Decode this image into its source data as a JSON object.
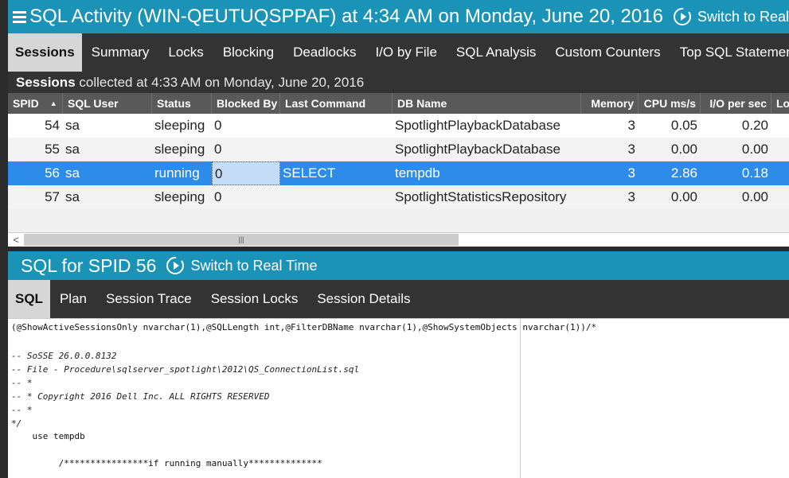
{
  "header": {
    "title": "SQL Activity (WIN-QEUTUQSPPAF) at 4:34 AM on Monday, June 20, 2016",
    "realtime_label": "Switch to Real"
  },
  "tabs": [
    "Sessions",
    "Summary",
    "Locks",
    "Blocking",
    "Deadlocks",
    "I/O by File",
    "SQL Analysis",
    "Custom Counters",
    "Top SQL Statements"
  ],
  "info": {
    "bold": "Sessions",
    "text": " collected at 4:33 AM on Monday, June 20, 2016"
  },
  "grid": {
    "columns": [
      "SPID",
      "SQL User",
      "Status",
      "Blocked By",
      "Last Command",
      "DB Name",
      "Memory",
      "CPU ms/s",
      "I/O per sec",
      "Lo"
    ],
    "rows": [
      [
        "54",
        "sa",
        "sleeping",
        "0",
        "",
        "SpotlightPlaybackDatabase",
        "3",
        "0.05",
        "0.20"
      ],
      [
        "55",
        "sa",
        "sleeping",
        "0",
        "",
        "SpotlightPlaybackDatabase",
        "3",
        "0.00",
        "0.00"
      ],
      [
        "56",
        "sa",
        "running",
        "0",
        "SELECT",
        "tempdb",
        "3",
        "2.86",
        "0.18"
      ],
      [
        "57",
        "sa",
        "sleeping",
        "0",
        "",
        "SpotlightStatisticsRepository",
        "3",
        "0.00",
        "0.00"
      ]
    ],
    "selected_row": 2
  },
  "sql_panel": {
    "title": "SQL for SPID 56",
    "realtime_label": "Switch to Real Time",
    "tabs": [
      "SQL",
      "Plan",
      "Session Trace",
      "Session Locks",
      "Session Details"
    ],
    "code_lines": [
      "(@ShowActiveSessionsOnly nvarchar(1),@SQLLength int,@FilterDBName nvarchar(1),@ShowSystemObjects nvarchar(1))/*",
      "",
      "-- SoSSE 26.0.0.8132",
      "-- File - Procedure\\sqlserver_spotlight\\2012\\QS_ConnectionList.sql",
      "-- *",
      "-- * Copyright 2016 Dell Inc. ALL RIGHTS RESERVED",
      "-- *",
      "*/",
      "    use tempdb",
      "",
      "         /****************if running manually**************"
    ]
  },
  "colors": {
    "accent": "#1b93b7",
    "selected": "#2d8cea",
    "dark": "#333333"
  }
}
